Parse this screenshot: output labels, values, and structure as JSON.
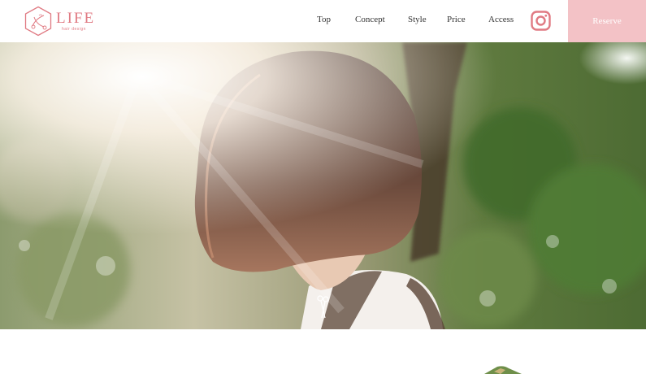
{
  "brand": {
    "name": "LIFE",
    "tagline": "hair design",
    "color": "#e07a83"
  },
  "nav": {
    "items": [
      {
        "label": "Top"
      },
      {
        "label": "Concept"
      },
      {
        "label": "Style"
      },
      {
        "label": "Price"
      },
      {
        "label": "Access"
      }
    ],
    "instagram_icon": "instagram-icon",
    "reserve_label": "Reserve",
    "reserve_color": "#f3c2c6"
  },
  "hero": {
    "image": "backlit photo of a woman with a bob haircut facing away, trees and sunlight",
    "scroll_icon": "scissors-icon"
  }
}
